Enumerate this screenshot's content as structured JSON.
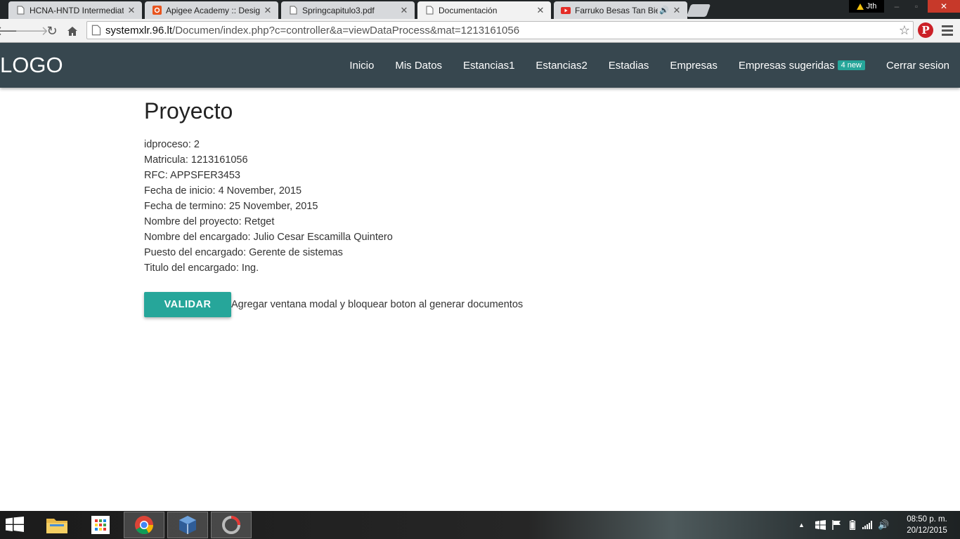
{
  "browser": {
    "tabs": [
      {
        "title": "HCNA-HNTD Intermediate",
        "active": false,
        "icon": "document-icon"
      },
      {
        "title": "Apigee Academy :: Design",
        "active": false,
        "icon": "apigee-icon"
      },
      {
        "title": "Springcapitulo3.pdf",
        "active": false,
        "icon": "document-icon"
      },
      {
        "title": "Documentación",
        "active": true,
        "icon": "document-icon"
      },
      {
        "title": "Farruko Besas Tan Bien",
        "active": false,
        "icon": "youtube-icon"
      }
    ],
    "profile_name": "Jth",
    "url_host": "systemxlr.96.lt",
    "url_path": "/Documen/index.php?c=controller&a=viewDataProcess&mat=1213161056"
  },
  "site": {
    "logo": "LOGO",
    "nav": [
      {
        "label": "Inicio"
      },
      {
        "label": "Mis Datos"
      },
      {
        "label": "Estancias1"
      },
      {
        "label": "Estancias2"
      },
      {
        "label": "Estadias"
      },
      {
        "label": "Empresas"
      },
      {
        "label": "Empresas sugeridas",
        "badge": "4 new"
      },
      {
        "label": "Cerrar sesion"
      }
    ],
    "accent_color": "#26a69a",
    "navbar_color": "#37474f"
  },
  "main": {
    "title": "Proyecto",
    "fields": [
      "idproceso: 2",
      "Matricula: 1213161056",
      "RFC: APPSFER3453",
      "Fecha de inicio: 4 November, 2015",
      "Fecha de termino: 25 November, 2015",
      "Nombre del proyecto: Retget",
      "Nombre del encargado: Julio Cesar Escamilla Quintero",
      "Puesto del encargado: Gerente de sistemas",
      "Titulo del encargado: Ing."
    ],
    "validate_button": "VALIDAR",
    "note": "Agregar ventana modal y bloquear boton al generar documentos"
  },
  "taskbar": {
    "time": "08:50 p. m.",
    "date": "20/12/2015"
  }
}
